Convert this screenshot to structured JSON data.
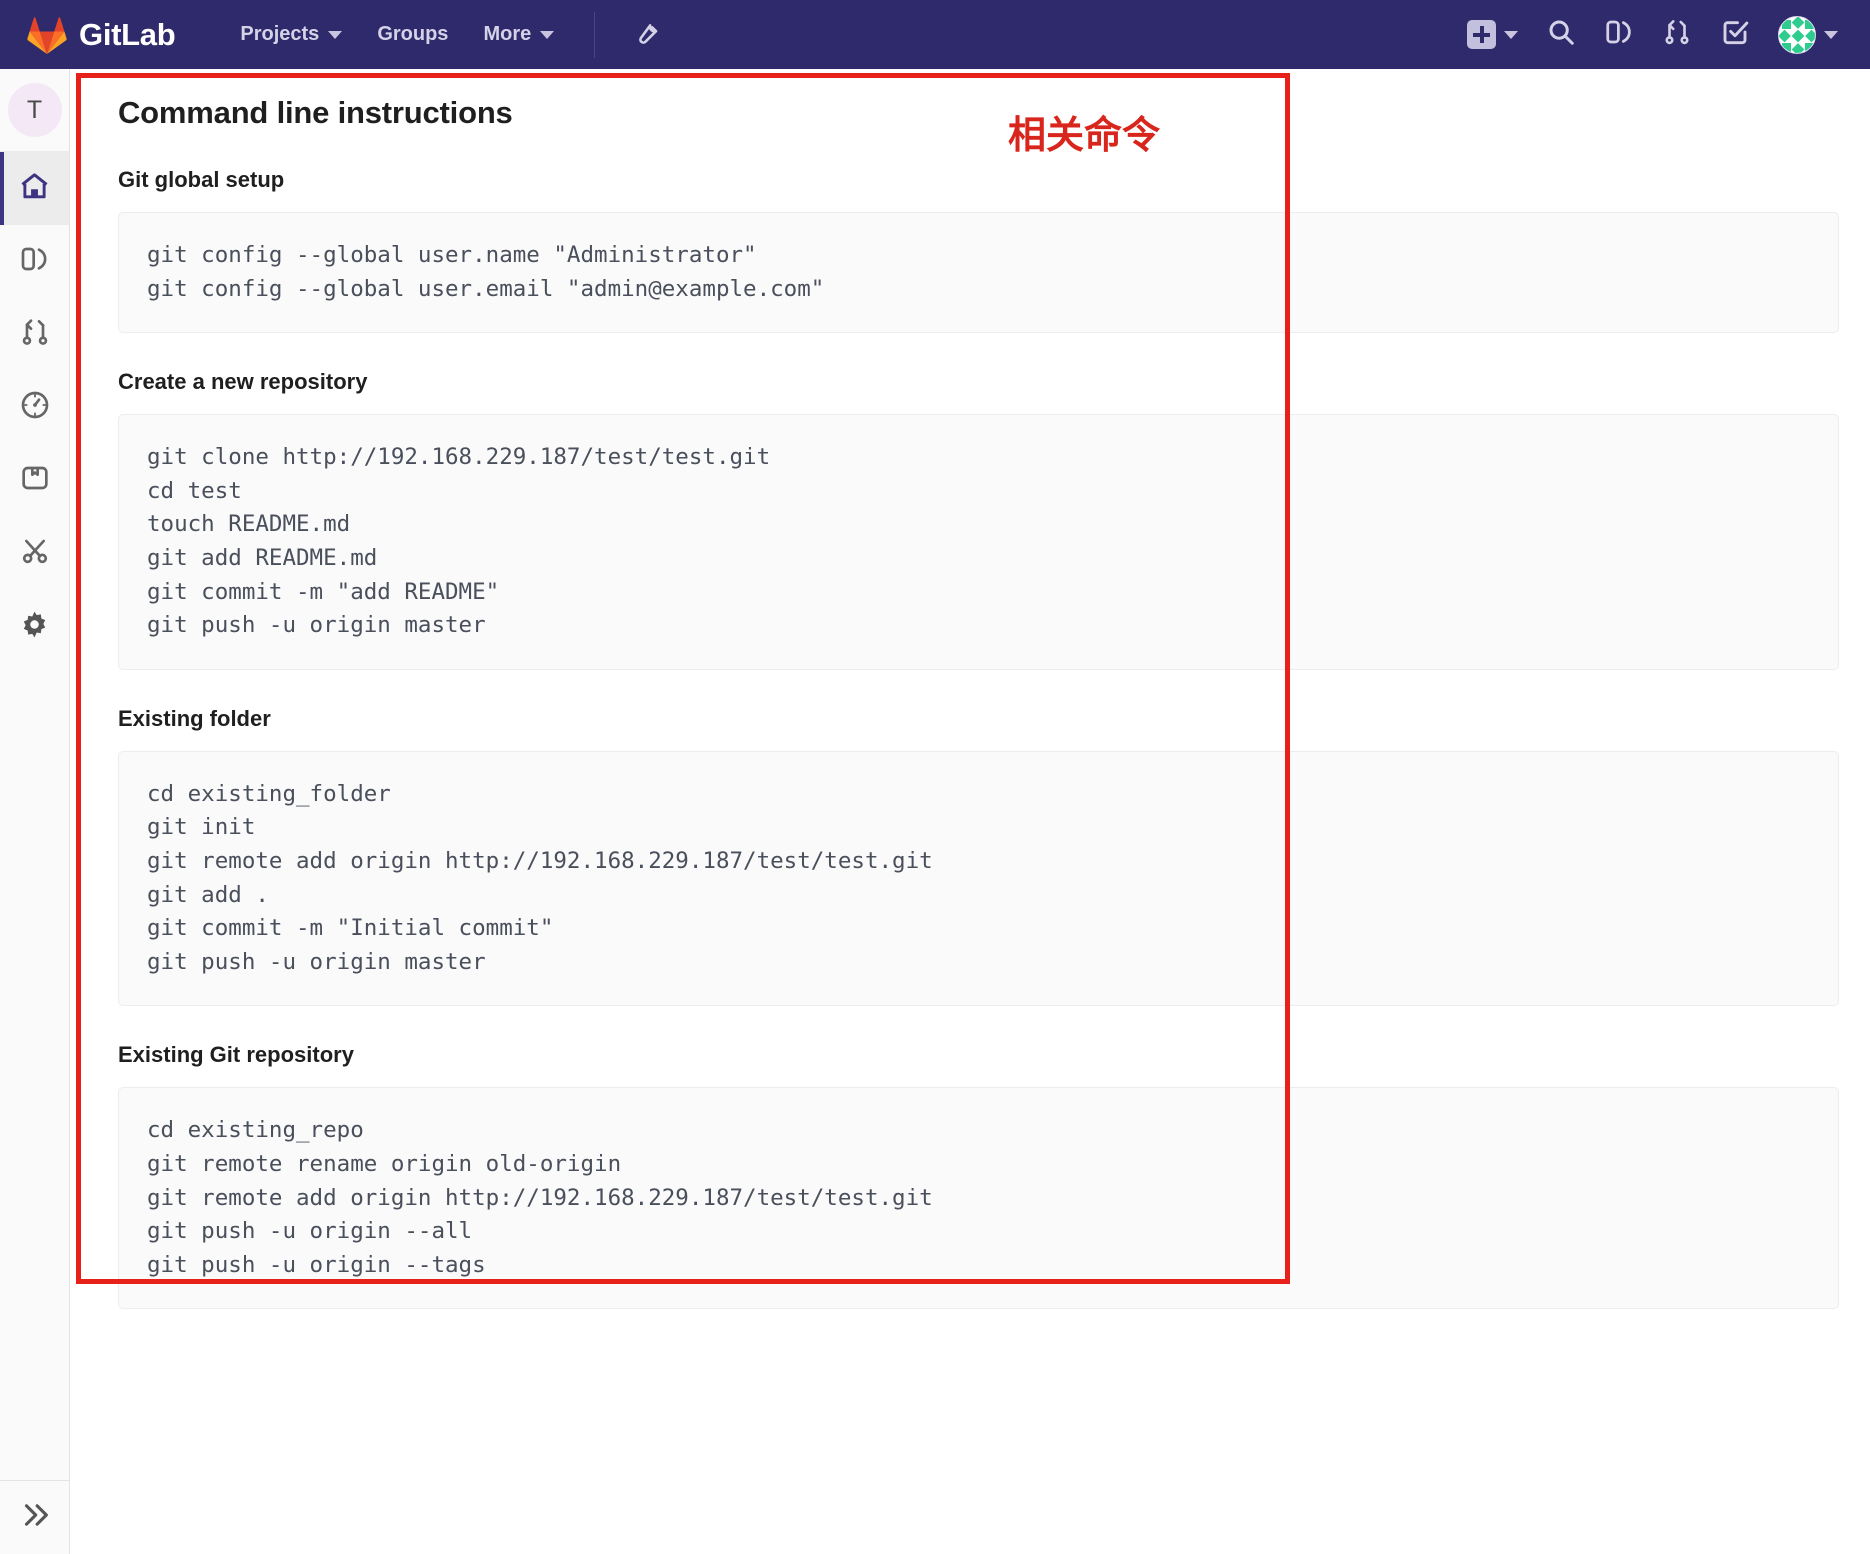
{
  "navbar": {
    "brand": "GitLab",
    "logo_icon": "gitlab-logo-icon",
    "links": [
      {
        "label": "Projects",
        "icon": "chevron-down-icon",
        "has_caret": true
      },
      {
        "label": "Groups",
        "icon": "",
        "has_caret": false
      },
      {
        "label": "More",
        "icon": "chevron-down-icon",
        "has_caret": true
      }
    ],
    "admin_icon": "wrench-icon",
    "actions": [
      {
        "name": "new-dropdown",
        "icon": "plus-square-icon"
      },
      {
        "name": "search",
        "icon": "search-icon"
      },
      {
        "name": "issues",
        "icon": "issues-icon"
      },
      {
        "name": "merge-requests",
        "icon": "merge-request-icon"
      },
      {
        "name": "todos",
        "icon": "todo-check-icon"
      },
      {
        "name": "user-menu",
        "icon": "avatar-icon"
      }
    ]
  },
  "sidebar": {
    "avatar_initial": "T",
    "items": [
      {
        "name": "project-home",
        "icon": "home-icon",
        "active": true
      },
      {
        "name": "issues",
        "icon": "issues-icon",
        "active": false
      },
      {
        "name": "merge-requests",
        "icon": "merge-request-icon",
        "active": false
      },
      {
        "name": "analytics",
        "icon": "gauge-icon",
        "active": false
      },
      {
        "name": "packages",
        "icon": "package-icon",
        "active": false
      },
      {
        "name": "snippets",
        "icon": "scissors-icon",
        "active": false
      },
      {
        "name": "settings",
        "icon": "gear-icon",
        "active": false
      }
    ],
    "collapse_icon": "chevron-double-right-icon"
  },
  "main": {
    "title": "Command line instructions",
    "sections": [
      {
        "heading": "Git global setup",
        "code": "git config --global user.name \"Administrator\"\ngit config --global user.email \"admin@example.com\""
      },
      {
        "heading": "Create a new repository",
        "code": "git clone http://192.168.229.187/test/test.git\ncd test\ntouch README.md\ngit add README.md\ngit commit -m \"add README\"\ngit push -u origin master"
      },
      {
        "heading": "Existing folder",
        "code": "cd existing_folder\ngit init\ngit remote add origin http://192.168.229.187/test/test.git\ngit add .\ngit commit -m \"Initial commit\"\ngit push -u origin master"
      },
      {
        "heading": "Existing Git repository",
        "code": "cd existing_repo\ngit remote rename origin old-origin\ngit remote add origin http://192.168.229.187/test/test.git\ngit push -u origin --all\ngit push -u origin --tags"
      }
    ]
  },
  "annotation": {
    "label": "相关命令",
    "color": "#d9261c",
    "box_color": "#e8201a"
  },
  "colors": {
    "navbar_bg": "#2f2a6b",
    "rail_bg": "#fafafa",
    "code_bg": "#fafafa",
    "accent": "#3d3383",
    "text": "#1f1f1f",
    "code_text": "#4a4f5c"
  }
}
